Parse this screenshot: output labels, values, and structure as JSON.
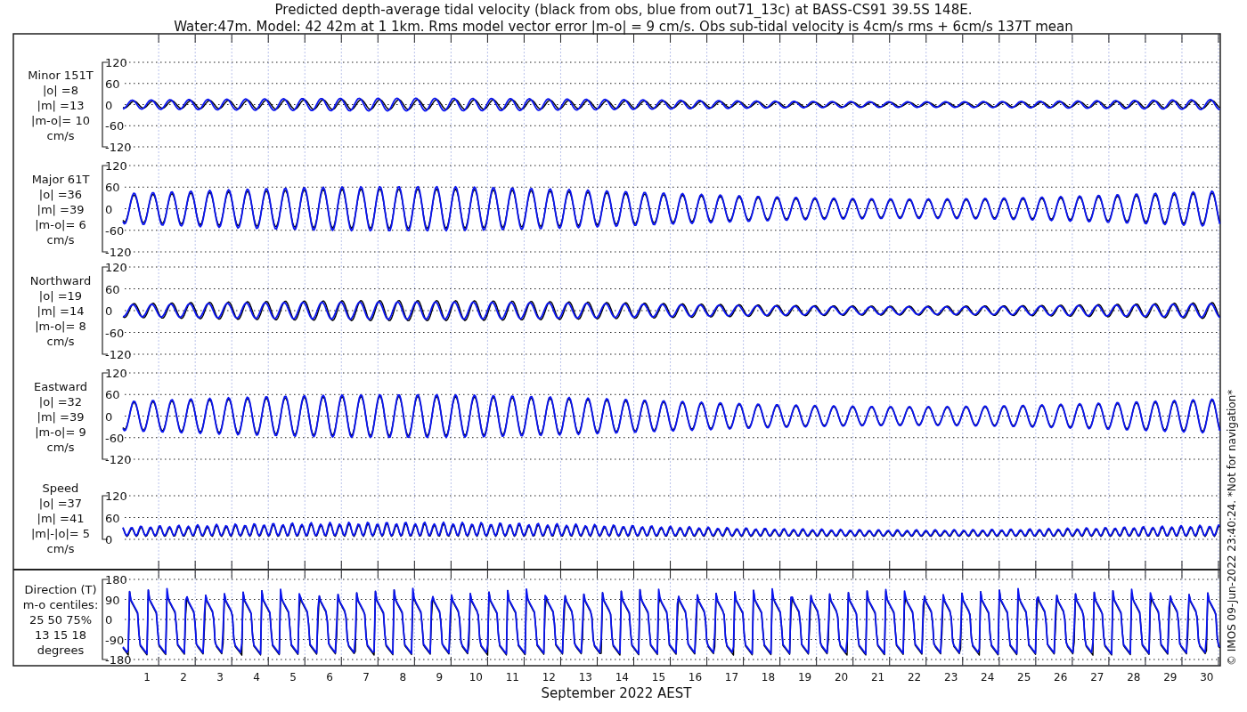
{
  "title_lines": [
    "Predicted depth-average tidal velocity (black from obs, blue from out71_13c) at BASS-CS91 39.5S 148E.",
    "Water:47m. Model: 42 42m at 1 1km. Rms model vector error |m-o| = 9 cm/s. Obs sub-tidal velocity is 4cm/s rms + 6cm/s 137T mean"
  ],
  "panels": [
    {
      "kind": "velocity",
      "label_lines": [
        "Minor 151T",
        "|o| =8",
        "|m| =13",
        "|m-o|= 10",
        "cm/s"
      ],
      "axis_labels": [
        "120",
        "60",
        "0",
        "-60",
        "-120"
      ]
    },
    {
      "kind": "velocity",
      "label_lines": [
        "Major 61T",
        "|o| =36",
        "|m| =39",
        "|m-o|= 6",
        "cm/s"
      ],
      "axis_labels": [
        "120",
        "60",
        "0",
        "-60",
        "-120"
      ]
    },
    {
      "kind": "velocity",
      "label_lines": [
        "Northward",
        "|o| =19",
        "|m| =14",
        "|m-o|= 8",
        "cm/s"
      ],
      "axis_labels": [
        "120",
        "60",
        "0",
        "-60",
        "-120"
      ]
    },
    {
      "kind": "velocity",
      "label_lines": [
        "Eastward",
        "|o| =32",
        "|m| =39",
        "|m-o|= 9",
        "cm/s"
      ],
      "axis_labels": [
        "120",
        "60",
        "0",
        "-60",
        "-120"
      ]
    },
    {
      "kind": "speed",
      "label_lines": [
        "Speed",
        "|o| =37",
        "|m| =41",
        "|m|-|o|= 5",
        "cm/s"
      ],
      "axis_labels": [
        "120",
        "60",
        "0"
      ]
    },
    {
      "kind": "direction",
      "label_lines": [
        "Direction (T)",
        "m-o centiles:",
        "25  50  75%",
        "13  15  18",
        "degrees"
      ],
      "axis_labels": [
        "180",
        "90",
        "0",
        "-90",
        "-180"
      ]
    }
  ],
  "day_labels": [
    "1",
    "2",
    "3",
    "4",
    "5",
    "6",
    "7",
    "8",
    "9",
    "10",
    "11",
    "12",
    "13",
    "14",
    "15",
    "16",
    "17",
    "18",
    "19",
    "20",
    "21",
    "22",
    "23",
    "24",
    "25",
    "26",
    "27",
    "28",
    "29",
    "30"
  ],
  "xlabel": "September 2022 AEST",
  "side_note": "© IMOS 09-Jun-2022 23:40:24. *Not for navigation*"
}
